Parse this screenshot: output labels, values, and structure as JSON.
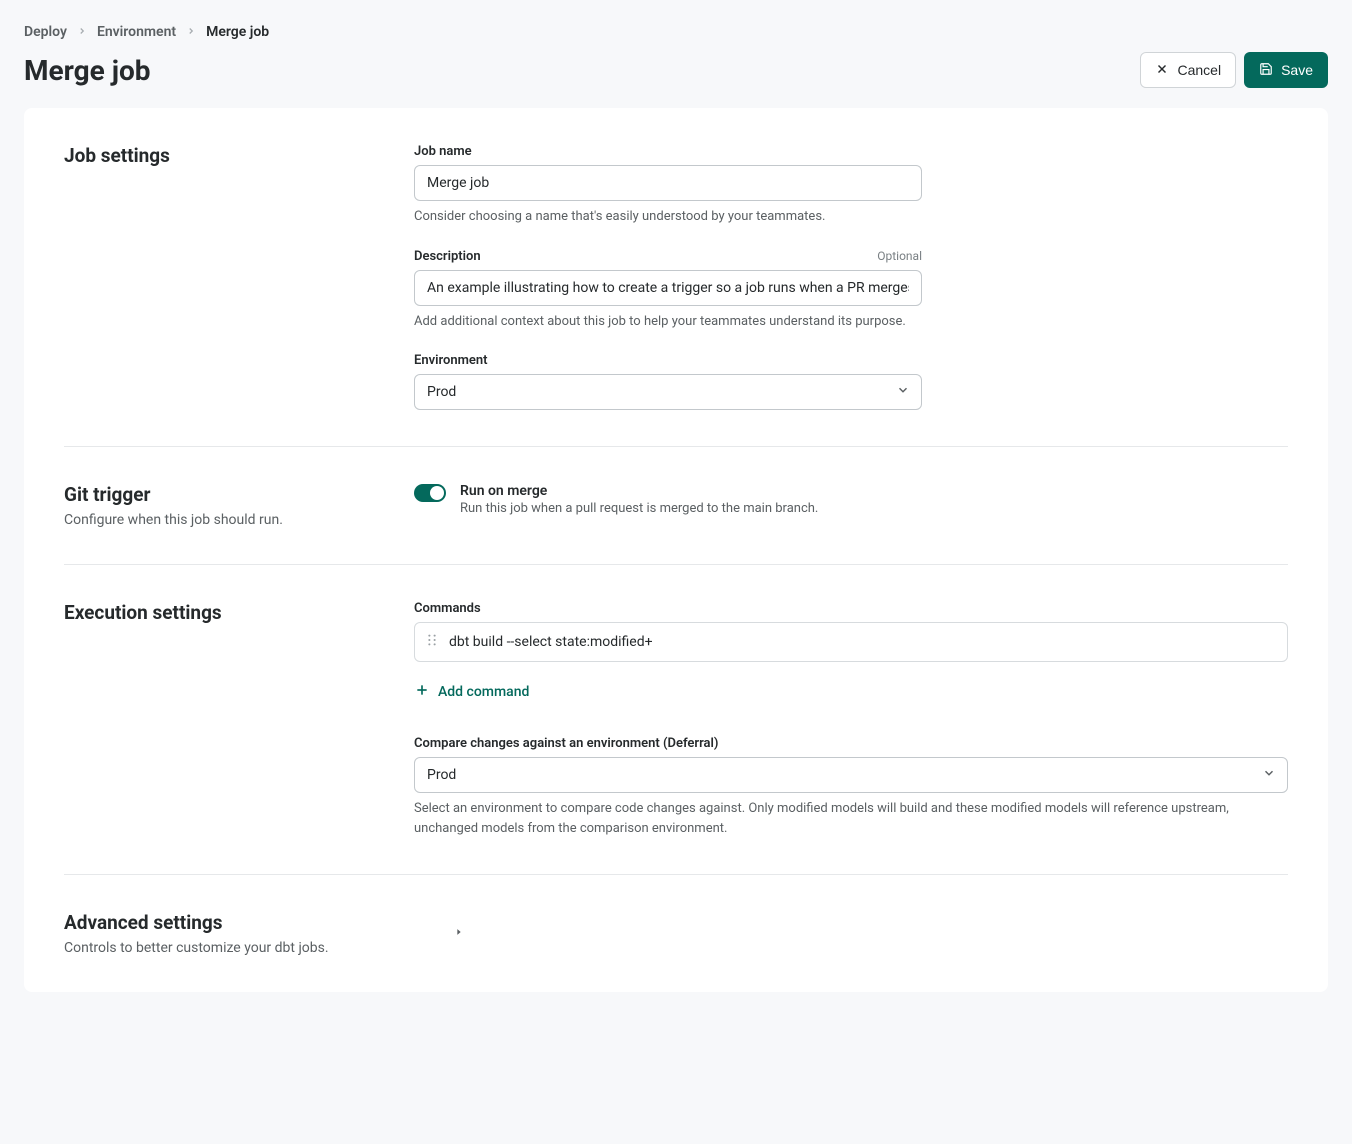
{
  "breadcrumb": {
    "deploy": "Deploy",
    "environment": "Environment",
    "current": "Merge job"
  },
  "page_title": "Merge job",
  "actions": {
    "cancel": "Cancel",
    "save": "Save"
  },
  "job_settings": {
    "title": "Job settings",
    "name_label": "Job name",
    "name_value": "Merge job",
    "name_hint": "Consider choosing a name that's easily understood by your teammates.",
    "desc_label": "Description",
    "desc_optional": "Optional",
    "desc_value": "An example illustrating how to create a trigger so a job runs when a PR merges.",
    "desc_hint": "Add additional context about this job to help your teammates understand its purpose.",
    "env_label": "Environment",
    "env_value": "Prod"
  },
  "git_trigger": {
    "title": "Git trigger",
    "subtitle": "Configure when this job should run.",
    "toggle_title": "Run on merge",
    "toggle_sub": "Run this job when a pull request is merged to the main branch.",
    "toggle_on": true
  },
  "execution": {
    "title": "Execution settings",
    "commands_label": "Commands",
    "commands": [
      "dbt build --select state:modified+"
    ],
    "add_command": "Add command",
    "deferral_label": "Compare changes against an environment (Deferral)",
    "deferral_value": "Prod",
    "deferral_hint": "Select an environment to compare code changes against. Only modified models will build and these modified models will reference upstream, unchanged models from the comparison environment."
  },
  "advanced": {
    "title": "Advanced settings",
    "subtitle": "Controls to better customize your dbt jobs."
  }
}
